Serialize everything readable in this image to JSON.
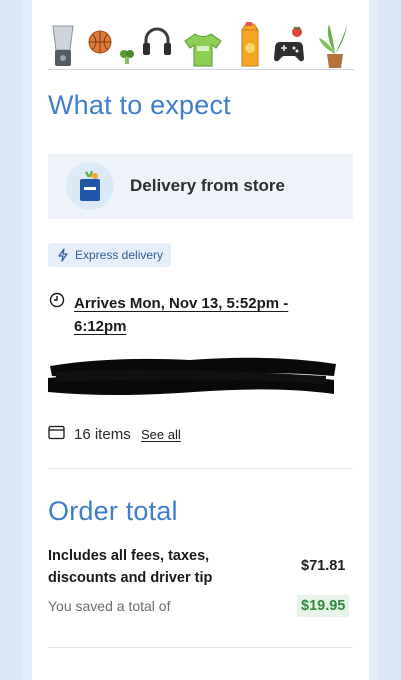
{
  "banner": {
    "icons": [
      "blender-icon",
      "basketball-icon",
      "broccoli-icon",
      "headphones-icon",
      "tshirt-icon",
      "juice-carton-icon",
      "tomato-icon",
      "gamepad-icon",
      "plant-icon"
    ]
  },
  "expect": {
    "heading": "What to expect",
    "store_title": "Delivery from store",
    "express_label": "Express delivery",
    "arrival": "Arrives Mon, Nov 13, 5:52pm - 6:12pm",
    "items_count": "16 items",
    "see_all": "See all"
  },
  "order": {
    "heading": "Order total",
    "fees_label": "Includes all fees, taxes, discounts and driver tip",
    "total": "$71.81",
    "saved_label": "You saved a total of",
    "saved_amount": "$19.95"
  },
  "colors": {
    "heading_blue": "#3f7ecb",
    "saved_green": "#2f8a3b",
    "saved_bg": "#e8f4ea"
  }
}
